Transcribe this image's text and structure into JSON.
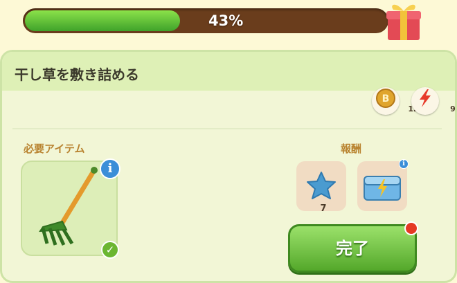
{
  "progress": {
    "percent_value": 0.43,
    "label": "43%"
  },
  "task": {
    "title": "干し草を敷き詰める"
  },
  "costs": [
    {
      "icon": "coin-icon",
      "value": "12"
    },
    {
      "icon": "lightning-icon",
      "value": "9"
    }
  ],
  "required": {
    "label": "必要アイテム",
    "item_icon": "rake-icon"
  },
  "rewards": {
    "label": "報酬",
    "items": [
      {
        "icon": "blue-star-icon",
        "count": "7"
      },
      {
        "icon": "blue-chest-icon"
      }
    ]
  },
  "complete_button": {
    "label": "完了"
  },
  "colors": {
    "progress_fill": "#4fb52d",
    "button": "#6cc23a",
    "accent": "#b98330"
  }
}
